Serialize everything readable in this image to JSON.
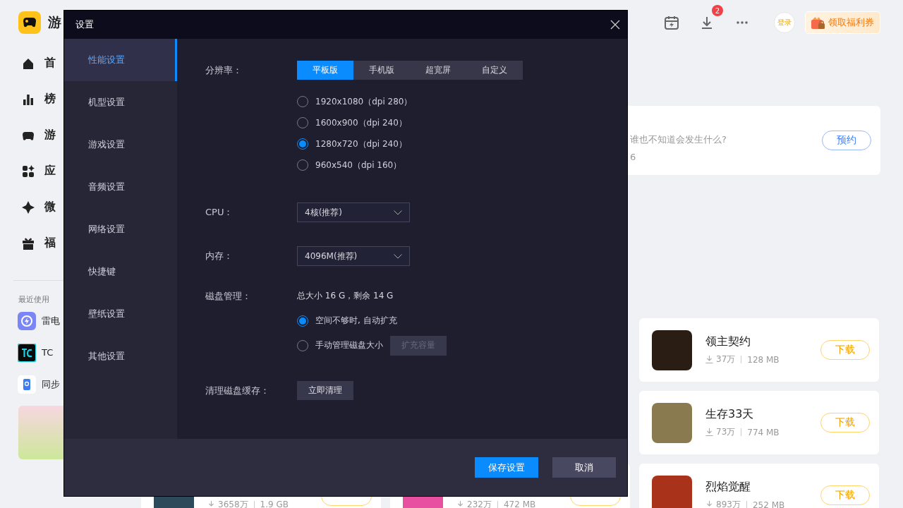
{
  "app": {
    "logo_text": "游"
  },
  "nav": [
    {
      "label": "首"
    },
    {
      "label": "榜"
    },
    {
      "label": "游"
    },
    {
      "label": "应"
    },
    {
      "label": "微"
    },
    {
      "label": "福"
    }
  ],
  "recent": {
    "heading": "最近使用",
    "items": [
      {
        "label": "雷电",
        "kind": "bolt"
      },
      {
        "label": "TC",
        "kind": "tc"
      },
      {
        "label": "同步",
        "kind": "phone"
      }
    ]
  },
  "toolbar": {
    "download_badge": "2",
    "login": "登录",
    "coupon": "领取福利券"
  },
  "featured": {
    "subtitle": "谁也不知道会发生什么?",
    "meta": "6",
    "button": "预约"
  },
  "games": [
    {
      "title": "领主契约",
      "downloads": "37万",
      "size": "128 MB",
      "button": "下载"
    },
    {
      "title": "生存33天",
      "downloads": "73万",
      "size": "774 MB",
      "button": "下载"
    },
    {
      "title": "烈焰觉醒",
      "downloads": "893万",
      "size": "252 MB",
      "button": "下载"
    }
  ],
  "partial_games": [
    {
      "downloads": "3658万",
      "size": "1.9 GB"
    },
    {
      "downloads": "232万",
      "size": "472 MB"
    }
  ],
  "dialog": {
    "title": "设置",
    "nav": [
      {
        "label": "性能设置",
        "selected": true
      },
      {
        "label": "机型设置",
        "selected": false
      },
      {
        "label": "游戏设置",
        "selected": false
      },
      {
        "label": "音频设置",
        "selected": false
      },
      {
        "label": "网络设置",
        "selected": false
      },
      {
        "label": "快捷键",
        "selected": false
      },
      {
        "label": "壁纸设置",
        "selected": false
      },
      {
        "label": "其他设置",
        "selected": false
      }
    ],
    "resolution": {
      "label": "分辨率：",
      "tabs": [
        {
          "label": "平板版",
          "selected": true
        },
        {
          "label": "手机版",
          "selected": false
        },
        {
          "label": "超宽屏",
          "selected": false
        },
        {
          "label": "自定义",
          "selected": false
        }
      ],
      "options": [
        {
          "label": "1920x1080（dpi 280）",
          "selected": false
        },
        {
          "label": "1600x900（dpi 240）",
          "selected": false
        },
        {
          "label": "1280x720（dpi 240）",
          "selected": true
        },
        {
          "label": "960x540（dpi 160）",
          "selected": false
        }
      ]
    },
    "cpu": {
      "label": "CPU：",
      "value": "4核(推荐)"
    },
    "memory": {
      "label": "内存：",
      "value": "4096M(推荐)"
    },
    "disk": {
      "label": "磁盘管理：",
      "summary": "总大小 16 G，剩余 14 G",
      "options": [
        {
          "label": "空间不够时, 自动扩充",
          "selected": true
        },
        {
          "label": "手动管理磁盘大小",
          "selected": false
        }
      ],
      "expand_button": {
        "label": "扩充容量",
        "disabled": true
      }
    },
    "clean": {
      "label": "清理磁盘缓存：",
      "button": "立即清理"
    },
    "save": "保存设置",
    "cancel": "取消"
  }
}
